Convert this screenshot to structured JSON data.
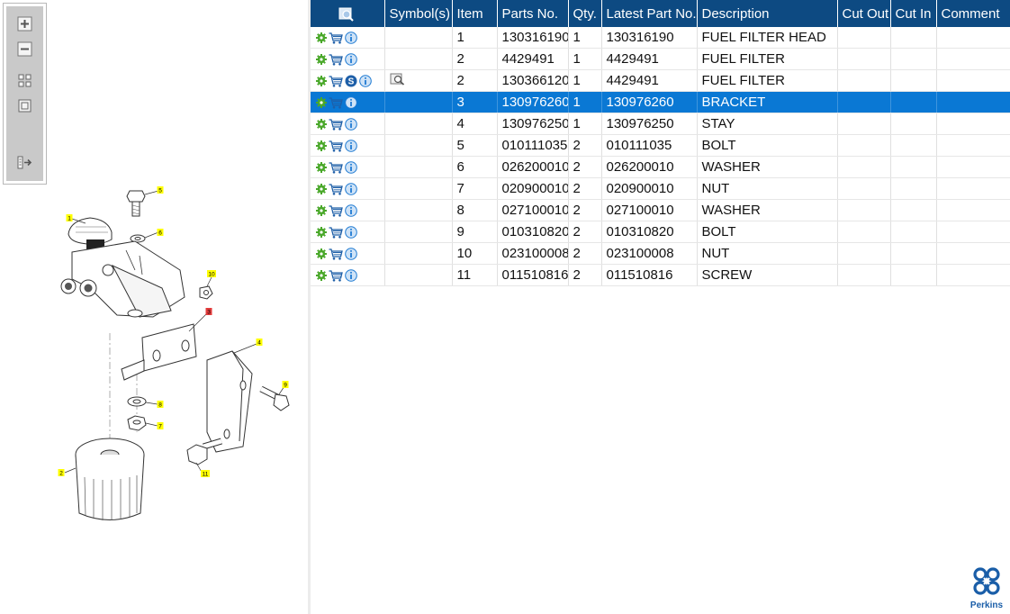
{
  "colors": {
    "header_bg": "#0d4a82",
    "selected_row_bg": "#0a78d4",
    "gear_icon": "#4aa82a",
    "cart_icon": "#1e5fa8",
    "info_icon": "#1e7ad2",
    "callout_yellow": "#ffff00",
    "callout_red": "#e33b3b"
  },
  "toolbar": {
    "buttons": [
      {
        "name": "zoom-in-icon"
      },
      {
        "name": "zoom-out-icon"
      },
      {
        "name": "fit-all-icon"
      },
      {
        "name": "fit-window-icon"
      },
      {
        "name": "export-icon"
      }
    ]
  },
  "diagram": {
    "callouts": [
      {
        "label": "1",
        "color": "yellow"
      },
      {
        "label": "2",
        "color": "yellow"
      },
      {
        "label": "3",
        "color": "red"
      },
      {
        "label": "4",
        "color": "yellow"
      },
      {
        "label": "5",
        "color": "yellow"
      },
      {
        "label": "6",
        "color": "yellow"
      },
      {
        "label": "7",
        "color": "yellow"
      },
      {
        "label": "8",
        "color": "yellow"
      },
      {
        "label": "9",
        "color": "yellow"
      },
      {
        "label": "10",
        "color": "yellow"
      },
      {
        "label": "11",
        "color": "yellow"
      }
    ]
  },
  "table": {
    "headers": {
      "view": "",
      "symbols": "Symbol(s)",
      "item": "Item",
      "parts_no": "Parts No.",
      "qty": "Qty.",
      "latest_part_no": "Latest Part No.",
      "description": "Description",
      "cut_out": "Cut Out",
      "cut_in": "Cut In",
      "comment": "Comment"
    },
    "rows": [
      {
        "item": "1",
        "parts_no": "130316190",
        "qty": "1",
        "latest_part_no": "130316190",
        "description": "FUEL FILTER HEAD",
        "cut_out": "",
        "cut_in": "",
        "comment": ""
      },
      {
        "item": "2",
        "parts_no": "4429491",
        "qty": "1",
        "latest_part_no": "4429491",
        "description": "FUEL FILTER",
        "cut_out": "",
        "cut_in": "",
        "comment": ""
      },
      {
        "item": "2",
        "parts_no": "130366120",
        "qty": "1",
        "latest_part_no": "4429491",
        "description": "FUEL FILTER",
        "cut_out": "",
        "cut_in": "",
        "comment": "",
        "supersession": "S",
        "has_symbol": true
      },
      {
        "item": "3",
        "parts_no": "130976260",
        "qty": "1",
        "latest_part_no": "130976260",
        "description": "BRACKET",
        "cut_out": "",
        "cut_in": "",
        "comment": "",
        "selected": true
      },
      {
        "item": "4",
        "parts_no": "130976250",
        "qty": "1",
        "latest_part_no": "130976250",
        "description": "STAY",
        "cut_out": "",
        "cut_in": "",
        "comment": ""
      },
      {
        "item": "5",
        "parts_no": "010111035",
        "qty": "2",
        "latest_part_no": "010111035",
        "description": "BOLT",
        "cut_out": "",
        "cut_in": "",
        "comment": ""
      },
      {
        "item": "6",
        "parts_no": "026200010",
        "qty": "2",
        "latest_part_no": "026200010",
        "description": "WASHER",
        "cut_out": "",
        "cut_in": "",
        "comment": ""
      },
      {
        "item": "7",
        "parts_no": "020900010",
        "qty": "2",
        "latest_part_no": "020900010",
        "description": "NUT",
        "cut_out": "",
        "cut_in": "",
        "comment": ""
      },
      {
        "item": "8",
        "parts_no": "027100010",
        "qty": "2",
        "latest_part_no": "027100010",
        "description": "WASHER",
        "cut_out": "",
        "cut_in": "",
        "comment": ""
      },
      {
        "item": "9",
        "parts_no": "010310820",
        "qty": "2",
        "latest_part_no": "010310820",
        "description": "BOLT",
        "cut_out": "",
        "cut_in": "",
        "comment": ""
      },
      {
        "item": "10",
        "parts_no": "023100008",
        "qty": "2",
        "latest_part_no": "023100008",
        "description": "NUT",
        "cut_out": "",
        "cut_in": "",
        "comment": ""
      },
      {
        "item": "11",
        "parts_no": "011510816",
        "qty": "2",
        "latest_part_no": "011510816",
        "description": "SCREW",
        "cut_out": "",
        "cut_in": "",
        "comment": ""
      }
    ]
  },
  "logo": {
    "text": "Perkins"
  }
}
